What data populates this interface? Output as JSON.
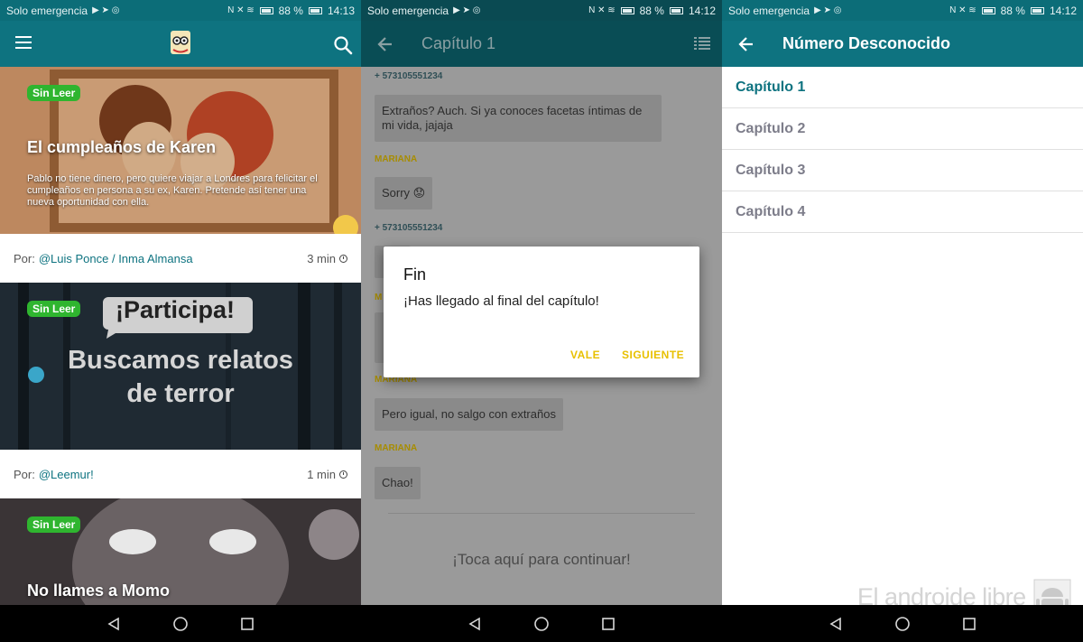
{
  "status_bars": [
    {
      "carrier": "Solo emergencia",
      "battery": "88 %",
      "time": "14:13"
    },
    {
      "carrier": "Solo emergencia",
      "battery": "88 %",
      "time": "14:12"
    },
    {
      "carrier": "Solo emergencia",
      "battery": "88 %",
      "time": "14:12"
    }
  ],
  "screen1": {
    "stories": [
      {
        "badge": "Sin Leer",
        "title": "El cumpleaños de Karen",
        "description": "Pablo no tiene dinero, pero quiere viajar a Londres para felicitar el cumpleaños en persona a su ex, Karen. Pretende así tener una nueva oportunidad con ella.",
        "by_label": "Por:",
        "author": "@Luis Ponce / Inma Almansa",
        "time": "3 min"
      },
      {
        "badge": "Sin Leer",
        "banner_callout": "¡Participa!",
        "banner_text": "Buscamos relatos de terror",
        "by_label": "Por:",
        "author": "@Leemur!",
        "time": "1 min"
      },
      {
        "badge": "Sin Leer",
        "title": "No llames a Momo"
      }
    ]
  },
  "screen2": {
    "title": "Capítulo 1",
    "messages": [
      {
        "sender": "+ 573105551234",
        "text": "Extraños? Auch. Si ya conoces facetas íntimas de mi vida, jajaja"
      },
      {
        "sender": "MARIANA",
        "text": "Sorry 😟"
      },
      {
        "sender": "+ 573105551234",
        "text": ""
      },
      {
        "sender": "MARIANA",
        "text": "Pero igual, no salgo con extraños"
      },
      {
        "sender": "MARIANA",
        "text": "Chao!"
      }
    ],
    "continue_text": "¡Toca aquí para continuar!",
    "dialog": {
      "title": "Fin",
      "message": "¡Has llegado al final del capítulo!",
      "ok_label": "VALE",
      "next_label": "SIGUIENTE"
    }
  },
  "screen3": {
    "title": "Número Desconocido",
    "chapters": [
      "Capítulo 1",
      "Capítulo 2",
      "Capítulo 3",
      "Capítulo 4"
    ],
    "active_chapter": "Capítulo 1"
  },
  "watermark": "El androide libre",
  "colors": {
    "primary": "#0e7380",
    "badge": "#2fb52f",
    "dialog_button": "#e8c000"
  }
}
